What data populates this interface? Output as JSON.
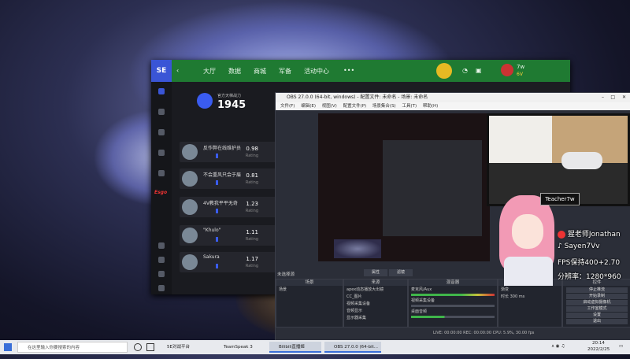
{
  "se_app": {
    "logo": "SE",
    "nav": [
      "大厅",
      "数据",
      "商城",
      "军备",
      "活动中心",
      "•••"
    ],
    "user": {
      "name": "7w",
      "level": "6V"
    },
    "rating_label": "官方天梯战力",
    "rating": "1945",
    "leaderboard": [
      {
        "name": "反作弊在线维护员",
        "value": "0.98",
        "label": "Rating"
      },
      {
        "name": "不会重风只会于眉",
        "value": "0.81",
        "label": "Rating"
      },
      {
        "name": "4V教我平平无奇",
        "value": "1.23",
        "label": "Rating"
      },
      {
        "name": "\"Khulo\"",
        "value": "1.11",
        "label": "Rating"
      },
      {
        "name": "Sakura",
        "value": "1.17",
        "label": "Rating"
      }
    ],
    "side_logo": "Esgo"
  },
  "obs": {
    "title": "OBS 27.0.0 (64-bit, windows) - 配置文件: 未命名 - 场景: 未命名",
    "menu": [
      "文件(F)",
      "编辑(E)",
      "视图(V)",
      "配置文件(P)",
      "场景集合(S)",
      "工具(T)",
      "帮助(H)"
    ],
    "no_source": "未选择源",
    "props_button": "属性",
    "filters_button": "滤镜",
    "docks": {
      "scenes": {
        "title": "场景",
        "items": [
          "场景"
        ]
      },
      "sources": {
        "title": "来源",
        "items": [
          "apex动态播放大出镜",
          "CC_图片",
          "视频采集设备",
          "音频显示",
          "显示器采集"
        ]
      },
      "mixer": {
        "title": "混音器",
        "items": [
          "麦克风/Aux",
          "视频采集设备",
          "桌面音频"
        ]
      },
      "transitions": {
        "title": "转场",
        "fade": "渐变",
        "duration_label": "时长",
        "duration": "300 ms"
      },
      "controls": {
        "title": "控件",
        "buttons": [
          "停止推流",
          "开始录制",
          "启动虚拟摄像机",
          "工作室模式",
          "设置",
          "退出"
        ]
      }
    },
    "status": "LIVE: 00:00:00   REC: 00:00:00   CPU: 5.9%, 30.00 fps"
  },
  "overlay": {
    "tp_label": "Teacher7w",
    "lines": [
      "猩老师Jonathan",
      "Sayen7Vv",
      "FPS保持400+2.70",
      "分辨率：1280*960"
    ]
  },
  "taskbar": {
    "search_placeholder": "在这里输入你要搜索的内容",
    "apps": [
      "5E对战平台",
      "TeamSpeak 3",
      "Bilibili直播姬",
      "OBS 27.0.0 (64-bit..."
    ],
    "time": "20:14",
    "date": "2022/2/25"
  },
  "colors": {
    "se_green": "#1f7a32",
    "se_blue": "#3a55d6",
    "obs_bg": "#2b2e38"
  }
}
